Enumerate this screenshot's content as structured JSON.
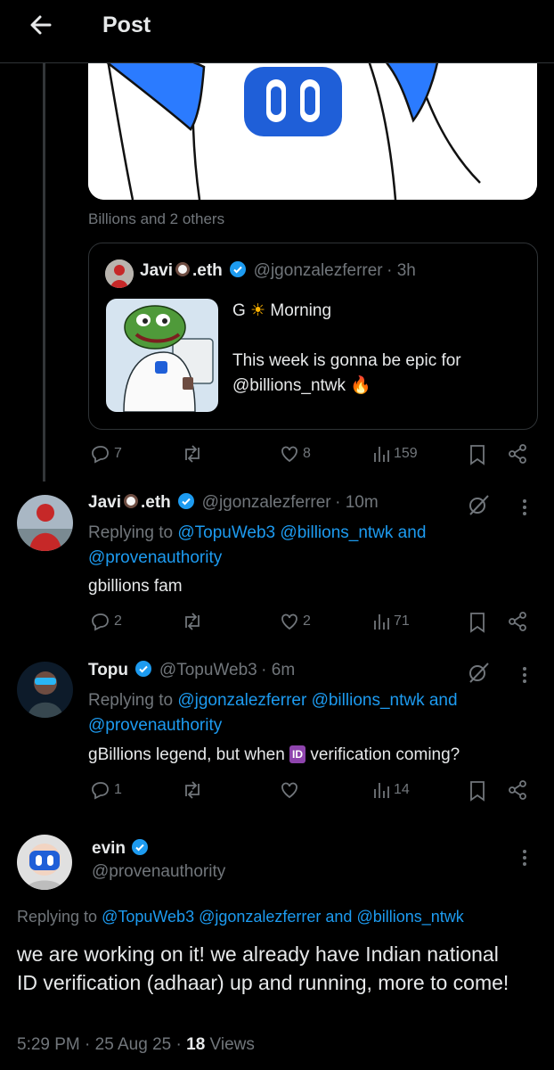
{
  "header": {
    "title": "Post"
  },
  "top_post": {
    "liked_by": "Billions and 2 others"
  },
  "quoted": {
    "name": "Javi",
    "name_suffix": ".eth",
    "handle": "@jgonzalezferrer",
    "time": "· 3h",
    "line1a": "G",
    "line1b": "Morning",
    "line2": "This week is gonna be epic for",
    "line3": "@billions_ntwk"
  },
  "top_actions": {
    "replies": "7",
    "likes": "8",
    "views": "159"
  },
  "reply1": {
    "name": "Javi",
    "name_suffix": ".eth",
    "handle": "@jgonzalezferrer",
    "time": "· 10m",
    "replying_to": "Replying to",
    "mentions": "@TopuWeb3 @billions_ntwk and",
    "mentions2": "@provenauthority",
    "text": "gbillions fam",
    "replies": "2",
    "likes": "2",
    "views": "71"
  },
  "reply2": {
    "name": "Topu",
    "handle": "@TopuWeb3",
    "time": "· 6m",
    "replying_to": "Replying to",
    "mentions": "@jgonzalezferrer @billions_ntwk and",
    "mentions2": "@provenauthority",
    "text_a": "gBillions legend, but when",
    "id_badge": "ID",
    "text_b": "verification coming?",
    "replies": "1",
    "likes": "",
    "views": "14"
  },
  "main": {
    "name": "evin",
    "handle": "@provenauthority",
    "replying_to": "Replying to",
    "mentions": "@TopuWeb3 @jgonzalezferrer and @billions_ntwk",
    "text": "we are working on it! we already have Indian national ID verification (adhaar) up and running, more to come!",
    "time": "5:29 PM · 25 Aug 25 ·",
    "views_count": "18",
    "views_label": "Views"
  },
  "colors": {
    "accent": "#1d9bf0",
    "muted": "#71767b",
    "border": "#2f3336",
    "brand_blue": "#1f5fd8"
  }
}
